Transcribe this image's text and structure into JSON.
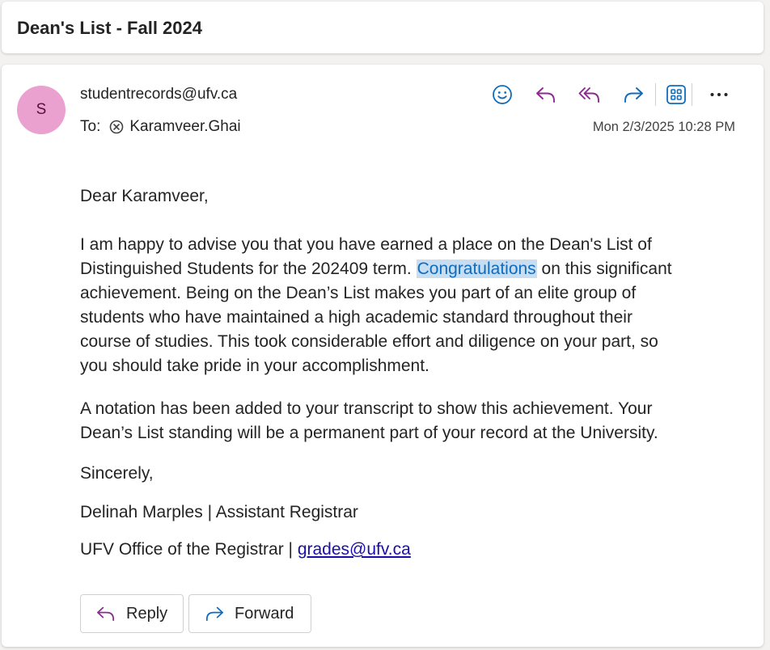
{
  "subject": "Dean's List - Fall 2024",
  "sender": {
    "avatar_initial": "S",
    "email": "studentrecords@ufv.ca",
    "avatar_color": "#eaa1cf"
  },
  "recipients": {
    "label": "To:",
    "name": "Karamveer.Ghai"
  },
  "date": "Mon 2/3/2025 10:28 PM",
  "actions": [
    {
      "name": "emoji-icon",
      "label": "React"
    },
    {
      "name": "reply-icon",
      "label": "Reply"
    },
    {
      "name": "reply-all-icon",
      "label": "Reply all"
    },
    {
      "name": "forward-icon",
      "label": "Forward"
    },
    {
      "name": "apps-icon",
      "label": "Apps"
    },
    {
      "name": "more-icon",
      "label": "More actions"
    }
  ],
  "body": {
    "greeting": "Dear Karamveer,",
    "para1_before": "I am happy to advise you that you have earned a place on the Dean's List of\nDistinguished Students for the 202409 term. ",
    "para1_highlight": "Congratulations",
    "para1_after": " on this significant\nachievement. Being on the Dean’s List makes you part of an elite group of\nstudents who have maintained a high academic standard throughout their\ncourse of studies. This took considerable effort and diligence on your part, so\nyou should take pride in your accomplishment.",
    "para2": "A notation has been added to your transcript to show this achievement. Your\nDean’s List standing will be a permanent part of your record at the University.",
    "closing": "Sincerely,",
    "signature_line1": "Delinah Marples | Assistant Registrar",
    "signature_line2_prefix": "UFV Office of the Registrar | ",
    "signature_email": "grades@ufv.ca"
  },
  "buttons": {
    "reply": "Reply",
    "forward": "Forward"
  },
  "colors": {
    "reply_purple": "#8a2b8f",
    "forward_blue": "#0f6cbd",
    "highlight_bg": "#c7ddf2"
  }
}
